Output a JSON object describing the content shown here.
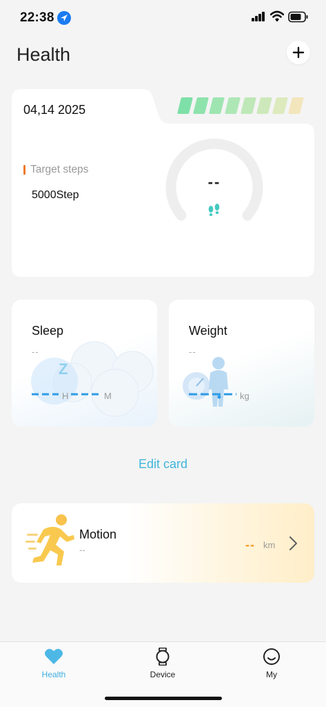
{
  "status_bar": {
    "time": "22:38"
  },
  "header": {
    "title": "Health",
    "add_icon": "plus-icon"
  },
  "steps_card": {
    "date": "04,14 2025",
    "target_label": "Target steps",
    "target_value": "5000Step",
    "steps_value": "--",
    "progress_colors": [
      "#7ee0a8",
      "#8ee3ad",
      "#9ee5b2",
      "#aee7b6",
      "#bee8b8",
      "#cde9bb",
      "#ddeabd",
      "#f3e6bd"
    ]
  },
  "sleep_card": {
    "title": "Sleep",
    "dash": "--",
    "unit_h": "H",
    "unit_m": "M"
  },
  "weight_card": {
    "title": "Weight",
    "dash": "--",
    "unit": "kg"
  },
  "edit_card": "Edit card",
  "motion_card": {
    "title": "Motion",
    "dash": "--",
    "value": "--",
    "unit": "km"
  },
  "tabs": [
    {
      "label": "Health",
      "icon": "heart-icon",
      "active": true
    },
    {
      "label": "Device",
      "icon": "watch-icon",
      "active": false
    },
    {
      "label": "My",
      "icon": "smiley-icon",
      "active": false
    }
  ],
  "colors": {
    "accent": "#3eaee0",
    "orange": "#f59a1f",
    "ring": "#eeeeee"
  }
}
